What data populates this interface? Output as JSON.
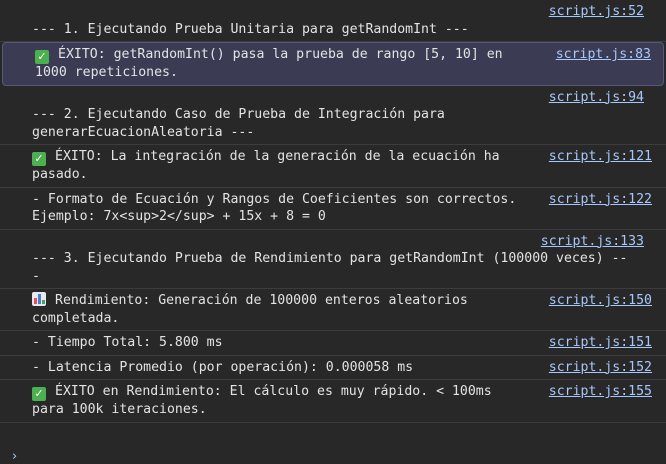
{
  "messages": [
    {
      "source": "script.js:52",
      "source_on_own_line": true,
      "icon": null,
      "text": "--- 1. Ejecutando Prueba Unitaria para getRandomInt ---"
    },
    {
      "source": "script.js:83",
      "source_on_own_line": false,
      "icon": "check-mark-icon",
      "highlight": true,
      "text": "ÉXITO: getRandomInt() pasa la prueba de rango [5, 10] en\n1000 repeticiones."
    },
    {
      "source": "script.js:94",
      "source_on_own_line": true,
      "icon": null,
      "text": "--- 2. Ejecutando Caso de Prueba de Integración para\ngenerarEcuacionAleatoria ---"
    },
    {
      "source": "script.js:121",
      "source_on_own_line": false,
      "icon": "check-mark-icon",
      "text": "ÉXITO: La integración de la generación de la ecuación ha\npasado."
    },
    {
      "source": "script.js:122",
      "source_on_own_line": false,
      "icon": null,
      "text": "- Formato de Ecuación y Rangos de Coeficientes son correctos.\nEjemplo: 7x<sup>2</sup> + 15x + 8 = 0"
    },
    {
      "source": "script.js:133",
      "source_on_own_line": true,
      "icon": null,
      "text": "--- 3. Ejecutando Prueba de Rendimiento para getRandomInt (100000 veces) --\n-"
    },
    {
      "source": "script.js:150",
      "source_on_own_line": false,
      "icon": "bar-chart-icon",
      "text": "Rendimiento: Generación de 100000 enteros aleatorios\ncompletada."
    },
    {
      "source": "script.js:151",
      "source_on_own_line": false,
      "icon": null,
      "text": "- Tiempo Total: 5.800 ms"
    },
    {
      "source": "script.js:152",
      "source_on_own_line": false,
      "icon": null,
      "text": "- Latencia Promedio (por operación): 0.000058 ms"
    },
    {
      "source": "script.js:155",
      "source_on_own_line": false,
      "icon": "check-mark-icon",
      "text": "ÉXITO en Rendimiento: El cálculo es muy rápido. < 100ms\npara 100k iteraciones."
    }
  ],
  "prompt_symbol": "›",
  "colors": {
    "background": "#282828",
    "text": "#e3e3e3",
    "link": "#a8c7fa",
    "highlight_background": "#3b3c54",
    "success_icon": "#4caf50"
  }
}
